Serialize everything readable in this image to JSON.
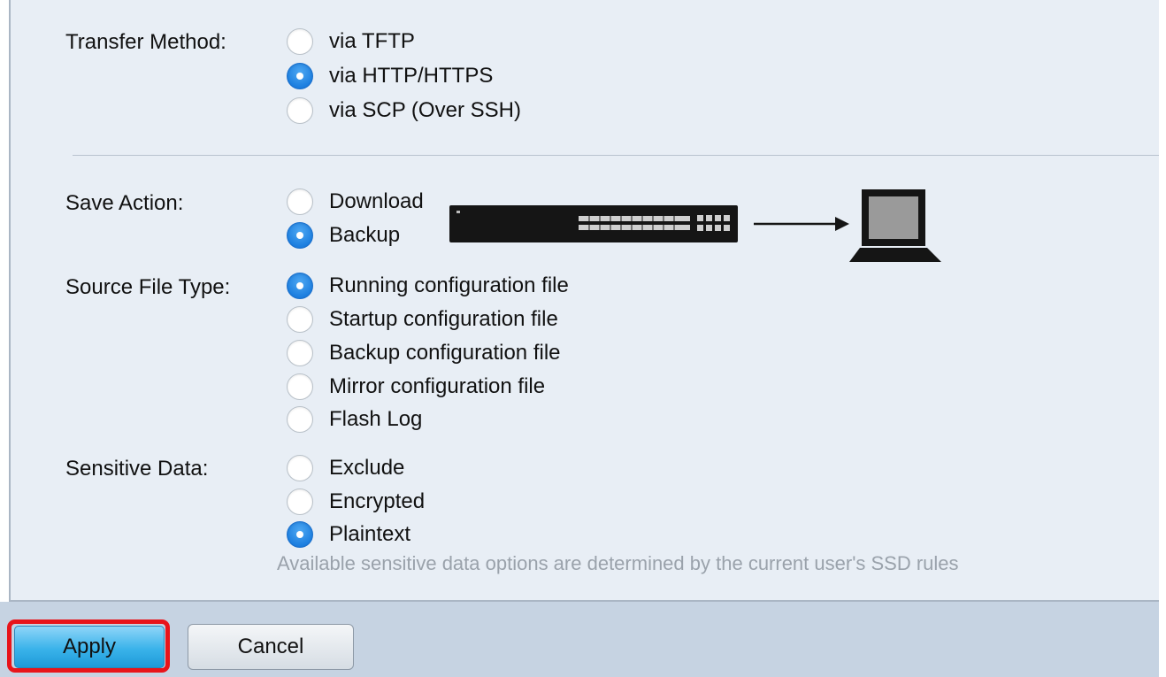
{
  "form": {
    "transfer_method": {
      "label": "Transfer Method:",
      "options": [
        {
          "label": "via TFTP",
          "checked": false
        },
        {
          "label": "via HTTP/HTTPS",
          "checked": true
        },
        {
          "label": "via SCP (Over SSH)",
          "checked": false
        }
      ]
    },
    "save_action": {
      "label": "Save Action:",
      "options": [
        {
          "label": "Download",
          "checked": false
        },
        {
          "label": "Backup",
          "checked": true
        }
      ]
    },
    "source_file_type": {
      "label": "Source File Type:",
      "options": [
        {
          "label": "Running configuration file",
          "checked": true
        },
        {
          "label": "Startup configuration file",
          "checked": false
        },
        {
          "label": "Backup configuration file",
          "checked": false
        },
        {
          "label": "Mirror configuration file",
          "checked": false
        },
        {
          "label": "Flash Log",
          "checked": false
        }
      ]
    },
    "sensitive_data": {
      "label": "Sensitive Data:",
      "options": [
        {
          "label": "Exclude",
          "checked": false
        },
        {
          "label": "Encrypted",
          "checked": false
        },
        {
          "label": "Plaintext",
          "checked": true
        }
      ],
      "hint": "Available sensitive data options are determined by the current user's SSD rules"
    }
  },
  "diagram": {
    "icons": [
      "network-switch-icon",
      "right-arrow-icon",
      "laptop-icon"
    ]
  },
  "buttons": {
    "apply": "Apply",
    "cancel": "Cancel"
  },
  "colors": {
    "panel_background": "#e8eef5",
    "button_bar": "#c6d3e2",
    "radio_selected": "#1d7fe0",
    "apply_highlight": "#e8141a"
  }
}
